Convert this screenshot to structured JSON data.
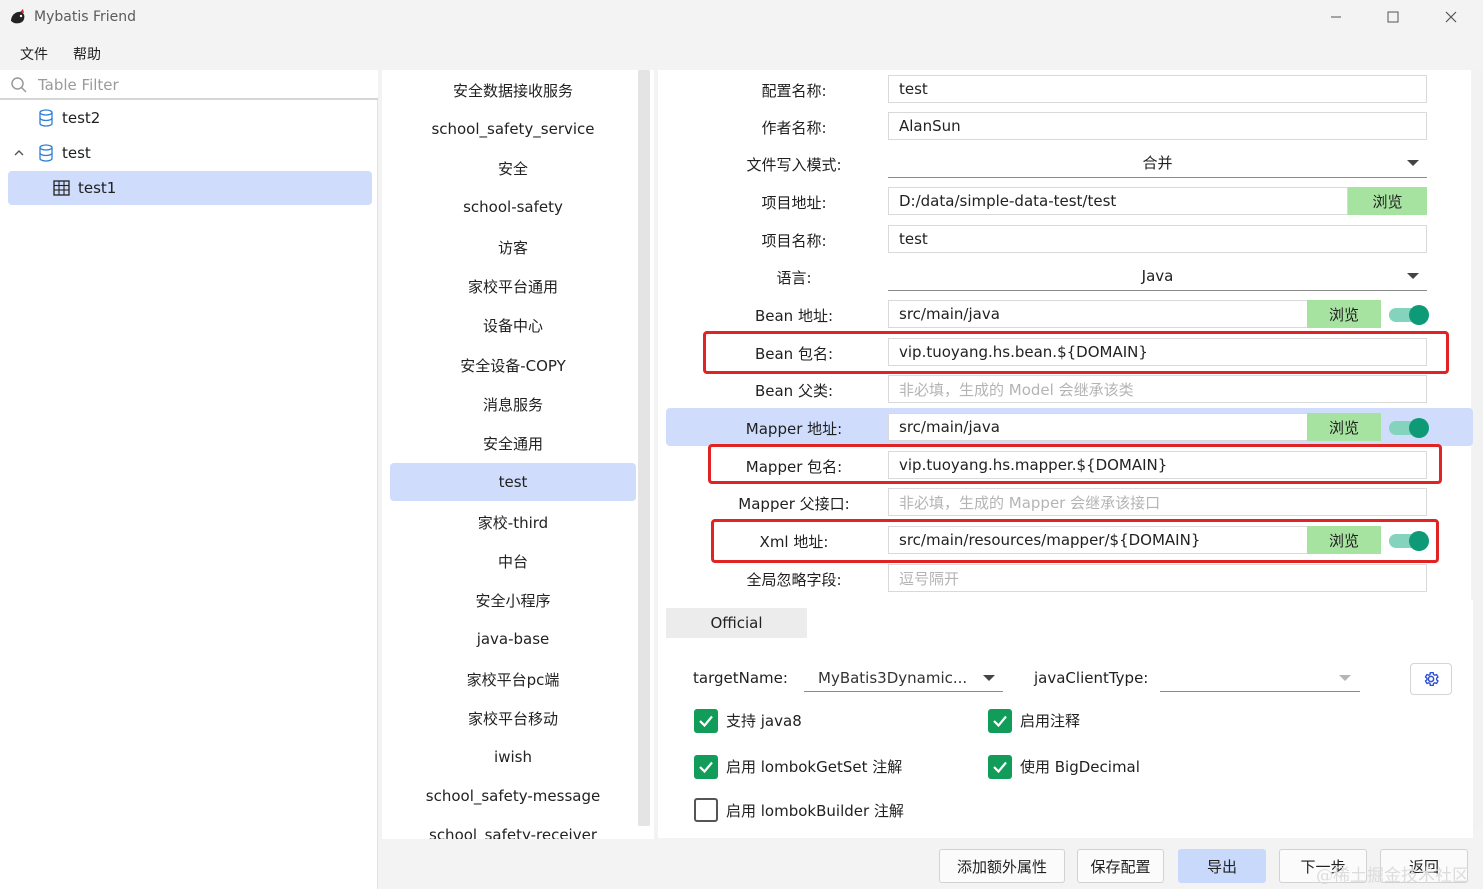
{
  "window": {
    "title": "Mybatis Friend",
    "minimize": "—",
    "maximize": "☐",
    "close": "✕"
  },
  "menu": [
    "文件",
    "帮助"
  ],
  "tree": {
    "filter_placeholder": "Table Filter",
    "nodes": [
      "test2",
      "test",
      "test1"
    ],
    "expand_glyph": "^"
  },
  "list": {
    "items": [
      "安全数据接收服务",
      "school_safety_service",
      "安全",
      "school-safety",
      "访客",
      "家校平台通用",
      "设备中心",
      "安全设备-COPY",
      "消息服务",
      "安全通用",
      "test",
      "家校-third",
      "中台",
      "安全小程序",
      "java-base",
      "家校平台pc端",
      "家校平台移动",
      "iwish",
      "school_safety-message",
      "school_safety-receiver"
    ],
    "selected": "test"
  },
  "form": {
    "config_name": {
      "label": "配置名称:",
      "value": "test"
    },
    "author_name": {
      "label": "作者名称:",
      "value": "AlanSun"
    },
    "write_mode": {
      "label": "文件写入模式:",
      "value": "合并"
    },
    "project_path": {
      "label": "项目地址:",
      "value": "D:/data/simple-data-test/test",
      "browse": "浏览"
    },
    "project_name": {
      "label": "项目名称:",
      "value": "test"
    },
    "language": {
      "label": "语言:",
      "value": "Java"
    },
    "bean_path": {
      "label": "Bean 地址:",
      "value": "src/main/java",
      "browse": "浏览"
    },
    "bean_package": {
      "label": "Bean 包名:",
      "value": "vip.tuoyang.hs.bean.${DOMAIN}"
    },
    "bean_parent": {
      "label": "Bean 父类:",
      "placeholder": "非必填，生成的 Model 会继承该类"
    },
    "mapper_path": {
      "label": "Mapper 地址:",
      "value": "src/main/java",
      "browse": "浏览"
    },
    "mapper_package": {
      "label": "Mapper 包名:",
      "value": "vip.tuoyang.hs.mapper.${DOMAIN}"
    },
    "mapper_parent": {
      "label": "Mapper 父接口:",
      "placeholder": "非必填，生成的 Mapper 会继承该接口"
    },
    "xml_path": {
      "label": "Xml 地址:",
      "value": "src/main/resources/mapper/${DOMAIN}",
      "browse": "浏览"
    },
    "ignore_fields": {
      "label": "全局忽略字段:",
      "placeholder": "逗号隔开"
    }
  },
  "options": {
    "tab": "Official",
    "target_name_label": "targetName:",
    "target_name_value": "MyBatis3Dynamic...",
    "java_client_type_label": "javaClientType:",
    "java_client_type_value": "",
    "checkboxes": [
      {
        "label": "支持 java8",
        "checked": true
      },
      {
        "label": "启用注释",
        "checked": true
      },
      {
        "label": "启用 lombokGetSet 注解",
        "checked": true
      },
      {
        "label": "使用 BigDecimal",
        "checked": true
      },
      {
        "label": "启用 lombokBuilder 注解",
        "checked": false
      }
    ]
  },
  "buttons": {
    "add_props": "添加额外属性",
    "save_config": "保存配置",
    "export": "导出",
    "next": "下一步",
    "back": "返回"
  },
  "watermark": "@稀土掘金技术社区",
  "colors": {
    "accent": "#cfdcfb",
    "browse_green": "#a6e2a0",
    "toggle_teal": "#0e9a77",
    "highlight_red": "#e02424",
    "checkbox_green": "#129c5a"
  }
}
